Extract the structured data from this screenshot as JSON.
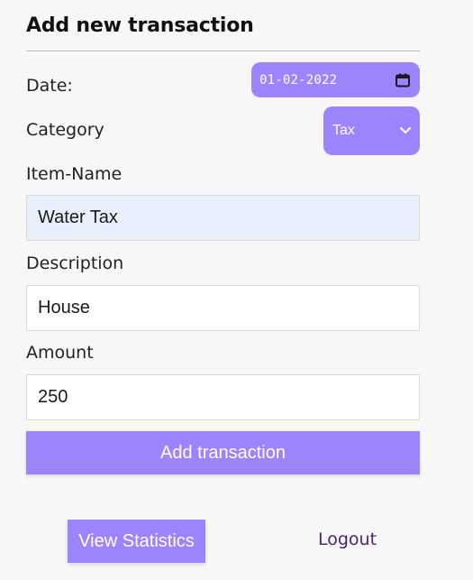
{
  "form": {
    "title": "Add new transaction",
    "date": {
      "label": "Date:",
      "value": "01-02-2022"
    },
    "category": {
      "label": "Category",
      "value": "Tax"
    },
    "item_name": {
      "label": "Item-Name",
      "value": "Water Tax"
    },
    "description": {
      "label": "Description",
      "value": "House"
    },
    "amount": {
      "label": "Amount",
      "value": "250"
    },
    "submit_label": "Add transaction"
  },
  "footer": {
    "stats_label": "View Statistics",
    "logout_label": "Logout"
  },
  "colors": {
    "accent": "#9d84ff",
    "autofill_background": "#e8f0fe",
    "logout_link": "#4a246f"
  }
}
